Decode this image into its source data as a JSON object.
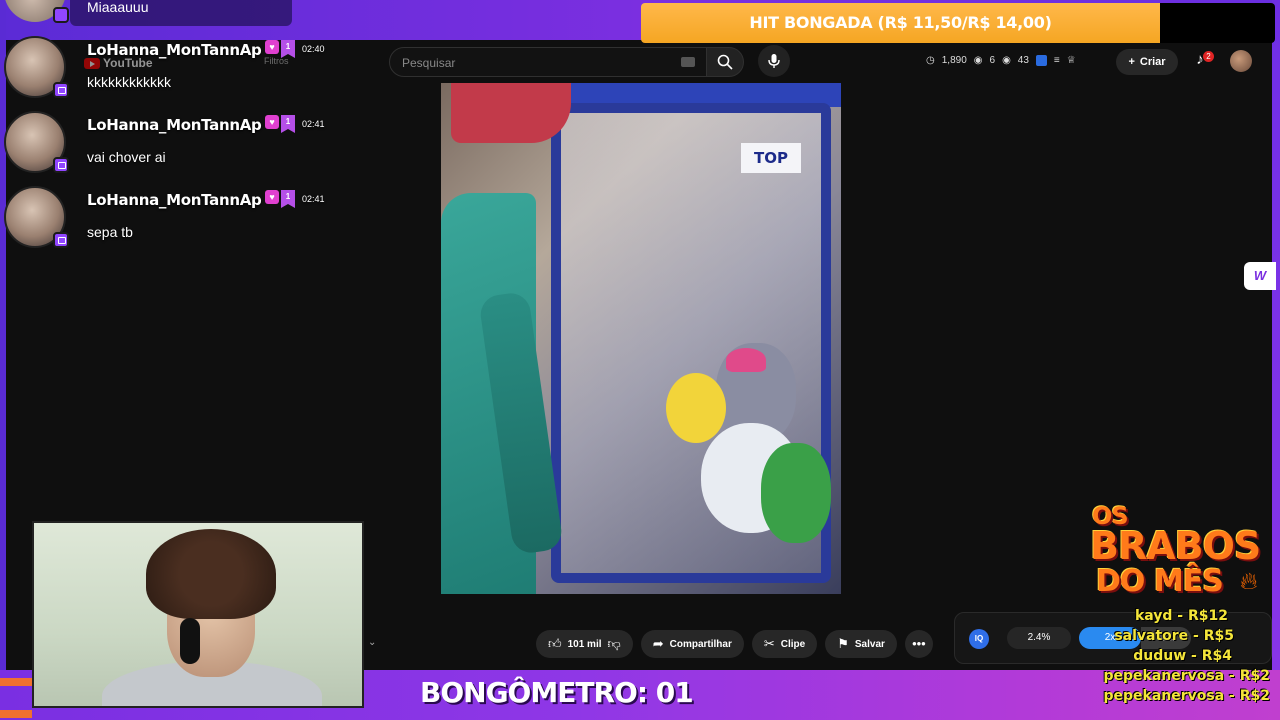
{
  "chat": {
    "top_message": "Miaaauuu",
    "messages": [
      {
        "user": "LoHanna_MonTannAp",
        "time": "02:40",
        "text": "kkkkkkkkkkkk",
        "sub_badge": "1"
      },
      {
        "user": "LoHanna_MonTannAp",
        "time": "02:41",
        "text": "vai chover ai",
        "sub_badge": "1"
      },
      {
        "user": "LoHanna_MonTannAp",
        "time": "02:41",
        "text": "sepa tb",
        "sub_badge": "1"
      }
    ]
  },
  "youtube": {
    "logo": "YouTube",
    "filter_label": "Filtros",
    "search_placeholder": "Pesquisar",
    "stats": {
      "cpu": "1,890",
      "views": "6",
      "other": "43"
    },
    "create_label": "Criar",
    "notification_count": "2"
  },
  "video": {
    "machine_brand": "TOP"
  },
  "actions": {
    "likes": "101 mil",
    "share": "Compartilhar",
    "clip": "Clipe",
    "save": "Salvar"
  },
  "player_ext": {
    "ext_label": "IQ",
    "percent": "2.4%",
    "speed": "2x",
    "bar2": "4.6x"
  },
  "hit_banner": "HIT BONGADA (R$ 11,50/R$ 14,00)",
  "brabos": {
    "line1": "OS",
    "line2": "BRABOS",
    "line3": "DO MÊS",
    "items": [
      "kayd - R$12",
      "salvatore - R$5",
      "duduw - R$4",
      "pepekanervosa - R$2",
      "pepekanervosa - R$2"
    ]
  },
  "bongometro": "BONGÔMETRO: 01",
  "colors": {
    "overlay_purple": "#7b2fe0",
    "banner_orange": "#f5a623",
    "youtube_bg": "#0f0f0f",
    "twitch": "#9146ff"
  }
}
